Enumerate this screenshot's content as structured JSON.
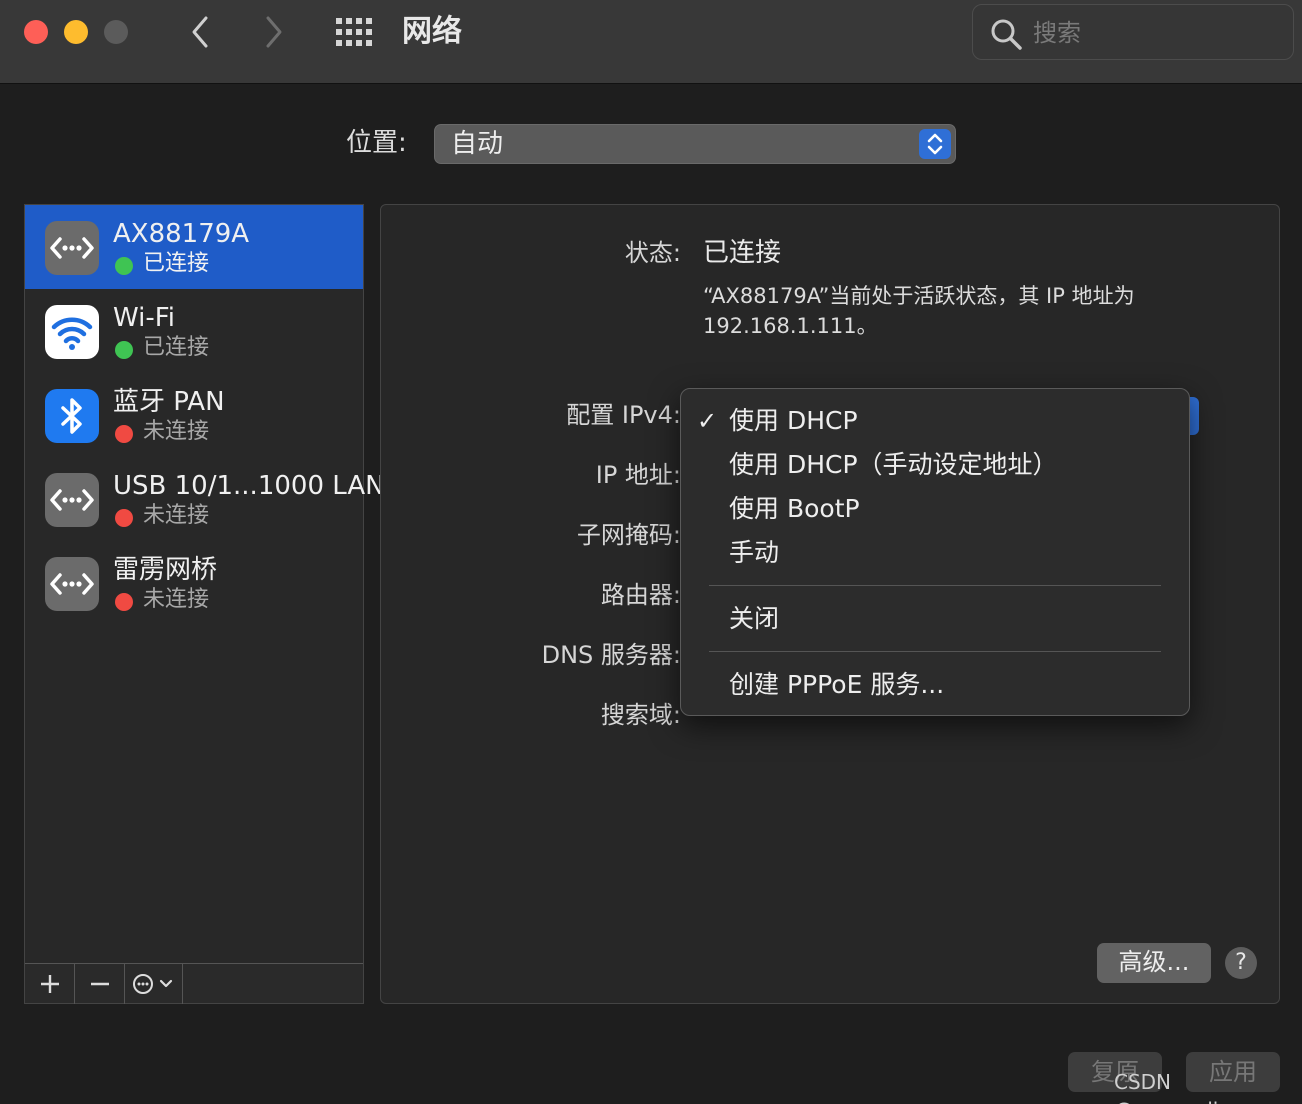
{
  "window": {
    "title": "网络",
    "search_placeholder": "搜索"
  },
  "location": {
    "label": "位置:",
    "value": "自动"
  },
  "services": [
    {
      "name": "AX88179A",
      "status": "已连接",
      "status_color": "#3fc453",
      "icon": "ethernet-icon",
      "selected": true
    },
    {
      "name": "Wi-Fi",
      "status": "已连接",
      "status_color": "#3fc453",
      "icon": "wifi-icon",
      "selected": false
    },
    {
      "name": "蓝牙 PAN",
      "status": "未连接",
      "status_color": "#f04a42",
      "icon": "bluetooth-icon",
      "selected": false
    },
    {
      "name": "USB 10/1...1000 LAN",
      "status": "未连接",
      "status_color": "#f04a42",
      "icon": "ethernet-icon",
      "selected": false
    },
    {
      "name": "雷雳网桥",
      "status": "未连接",
      "status_color": "#f04a42",
      "icon": "ethernet-icon",
      "selected": false
    }
  ],
  "details": {
    "status_label": "状态:",
    "status_value": "已连接",
    "status_desc": "“AX88179A”当前处于活跃状态，其 IP 地址为 192.168.1.111。",
    "config_label": "配置 IPv4:",
    "ip_label": "IP 地址:",
    "subnet_label": "子网掩码:",
    "router_label": "路由器:",
    "dns_label": "DNS 服务器:",
    "search_domain_label": "搜索域:",
    "advanced_button": "高级...",
    "help_button": "?"
  },
  "ipv4_menu": {
    "items": [
      {
        "label": "使用 DHCP",
        "checked": true
      },
      {
        "label": "使用 DHCP（手动设定地址）",
        "checked": false
      },
      {
        "label": "使用 BootP",
        "checked": false
      },
      {
        "label": "手动",
        "checked": false
      },
      {
        "label": "关闭",
        "checked": false
      },
      {
        "label": "创建 PPPoE 服务...",
        "checked": false
      }
    ],
    "check_mark": "✓"
  },
  "footer": {
    "revert_button": "复原",
    "apply_button": "应用",
    "watermark": "CSDN @caesarding"
  },
  "colors": {
    "accent": "#1f5cc8",
    "connected": "#3fc453",
    "disconnected": "#f04a42"
  }
}
